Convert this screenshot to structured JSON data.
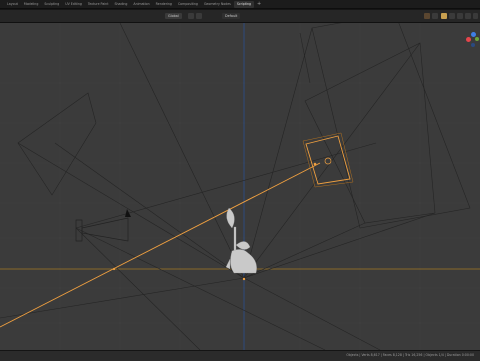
{
  "workspace_tabs": [
    {
      "label": "Layout",
      "active": false
    },
    {
      "label": "Modeling",
      "active": false
    },
    {
      "label": "Sculpting",
      "active": false
    },
    {
      "label": "UV Editing",
      "active": false
    },
    {
      "label": "Texture Paint",
      "active": false
    },
    {
      "label": "Shading",
      "active": false
    },
    {
      "label": "Animation",
      "active": false
    },
    {
      "label": "Rendering",
      "active": false
    },
    {
      "label": "Compositing",
      "active": false
    },
    {
      "label": "Geometry Nodes",
      "active": false
    },
    {
      "label": "Scripting",
      "active": true
    }
  ],
  "add_workspace_label": "+",
  "header": {
    "orientation_label": "Global",
    "pivot_label": "Default"
  },
  "gizmo": {
    "axis_colors": {
      "x": "#e5454b",
      "y": "#6ba33a",
      "z": "#3f7ee6"
    }
  },
  "status": {
    "text": "Objects | Verts 8,617 | Faces 8,128 | Tris 16,256 | Objects 1/4 | Duration 0:00:00"
  },
  "colors": {
    "viewport_bg": "#3b3b3b",
    "selection": "#f0a040",
    "grid_major": "#8a6a2a"
  }
}
